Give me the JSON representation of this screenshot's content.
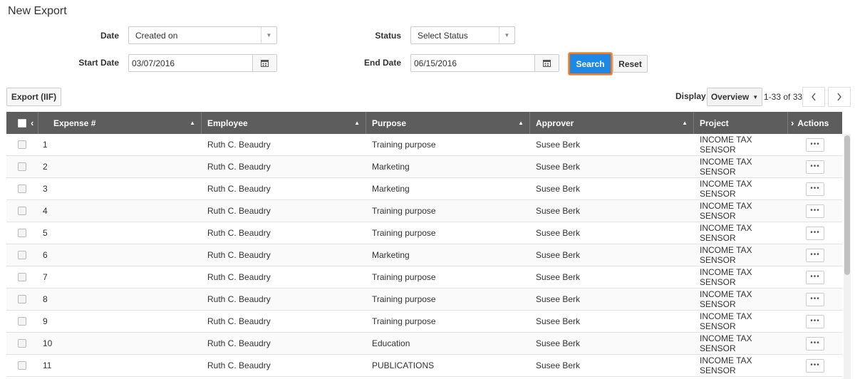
{
  "page": {
    "title": "New Export"
  },
  "filters": {
    "date_label": "Date",
    "date_value": "Created on",
    "status_label": "Status",
    "status_value": "Select Status",
    "start_label": "Start Date",
    "start_value": "03/07/2016",
    "end_label": "End Date",
    "end_value": "06/15/2016",
    "search_label": "Search",
    "reset_label": "Reset"
  },
  "toolbar": {
    "export_label": "Export (IIF)",
    "display_label": "Display",
    "display_value": "Overview",
    "range": "1-33 of 33"
  },
  "table": {
    "headers": [
      "Expense #",
      "Employee",
      "Purpose",
      "Approver",
      "Project",
      "Actions"
    ],
    "rows": [
      {
        "id": "1",
        "employee": "Ruth C. Beaudry",
        "purpose": "Training purpose",
        "approver": "Susee Berk",
        "project": "INCOME TAX SENSOR"
      },
      {
        "id": "2",
        "employee": "Ruth C. Beaudry",
        "purpose": "Marketing",
        "approver": "Susee Berk",
        "project": "INCOME TAX SENSOR"
      },
      {
        "id": "3",
        "employee": "Ruth C. Beaudry",
        "purpose": "Marketing",
        "approver": "Susee Berk",
        "project": "INCOME TAX SENSOR"
      },
      {
        "id": "4",
        "employee": "Ruth C. Beaudry",
        "purpose": "Training purpose",
        "approver": "Susee Berk",
        "project": "INCOME TAX SENSOR"
      },
      {
        "id": "5",
        "employee": "Ruth C. Beaudry",
        "purpose": "Training purpose",
        "approver": "Susee Berk",
        "project": "INCOME TAX SENSOR"
      },
      {
        "id": "6",
        "employee": "Ruth C. Beaudry",
        "purpose": "Marketing",
        "approver": "Susee Berk",
        "project": "INCOME TAX SENSOR"
      },
      {
        "id": "7",
        "employee": "Ruth C. Beaudry",
        "purpose": "Training purpose",
        "approver": "Susee Berk",
        "project": "INCOME TAX SENSOR"
      },
      {
        "id": "8",
        "employee": "Ruth C. Beaudry",
        "purpose": "Training purpose",
        "approver": "Susee Berk",
        "project": "INCOME TAX SENSOR"
      },
      {
        "id": "9",
        "employee": "Ruth C. Beaudry",
        "purpose": "Training purpose",
        "approver": "Susee Berk",
        "project": "INCOME TAX SENSOR"
      },
      {
        "id": "10",
        "employee": "Ruth C. Beaudry",
        "purpose": "Education",
        "approver": "Susee Berk",
        "project": "INCOME TAX SENSOR"
      },
      {
        "id": "11",
        "employee": "Ruth C. Beaudry",
        "purpose": "PUBLICATIONS",
        "approver": "Susee Berk",
        "project": "INCOME TAX SENSOR"
      }
    ]
  },
  "colors": {
    "accent": "#1e88e5",
    "focus_ring": "#f07a24",
    "header_bg": "#5d5d5d"
  }
}
